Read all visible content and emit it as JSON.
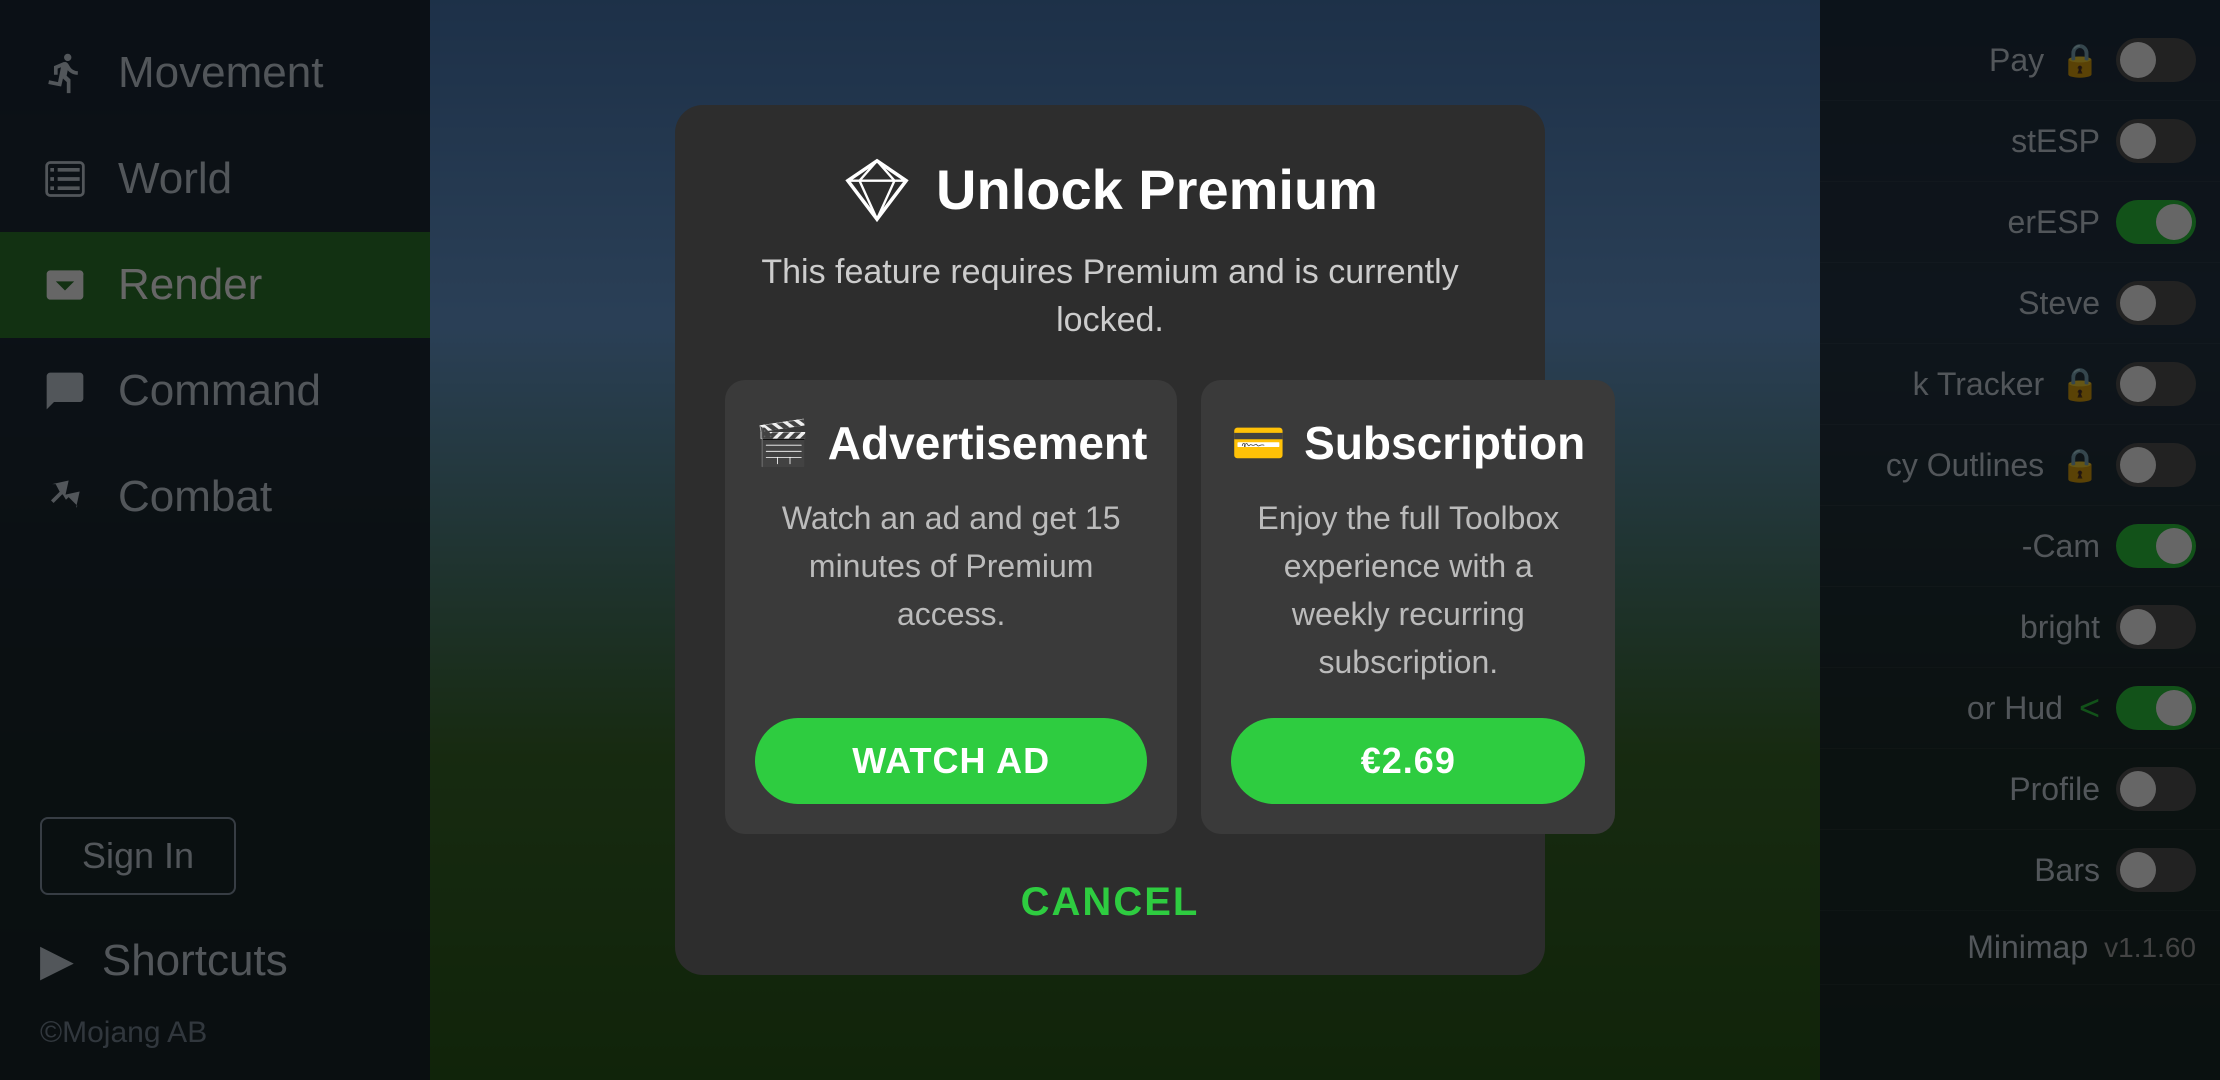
{
  "sidebar": {
    "items": [
      {
        "id": "movement",
        "label": "Movement",
        "icon": "🏃"
      },
      {
        "id": "world",
        "label": "World",
        "icon": "⬜"
      },
      {
        "id": "render",
        "label": "Render",
        "icon": "📷",
        "active": true
      },
      {
        "id": "command",
        "label": "Command",
        "icon": "💬"
      },
      {
        "id": "combat",
        "label": "Combat",
        "icon": "⚔"
      }
    ],
    "sign_in_label": "Sign In",
    "shortcuts_label": "Shortcuts",
    "shortcuts_icon": "▶",
    "mojang_label": "©Mojang AB"
  },
  "right_panel": {
    "items": [
      {
        "id": "pay",
        "label": "Pay",
        "locked": true,
        "toggle": "off"
      },
      {
        "id": "stESP",
        "label": "stESP",
        "locked": false,
        "toggle": "off"
      },
      {
        "id": "erESP",
        "label": "erESP",
        "locked": false,
        "toggle": "on"
      },
      {
        "id": "steve",
        "label": "Steve",
        "locked": false,
        "toggle": "off"
      },
      {
        "id": "tracker",
        "label": "k Tracker",
        "locked": true,
        "toggle": "off"
      },
      {
        "id": "outlines",
        "label": "cy Outlines",
        "locked": true,
        "toggle": "off"
      },
      {
        "id": "cam",
        "label": "-Cam",
        "locked": false,
        "toggle": "on"
      },
      {
        "id": "bright",
        "label": "bright",
        "locked": false,
        "toggle": "off"
      },
      {
        "id": "hud",
        "label": "or Hud",
        "locked": false,
        "toggle": "chevron",
        "chevron": "<"
      },
      {
        "id": "profile",
        "label": "Profile",
        "locked": false,
        "toggle": "off"
      },
      {
        "id": "bars",
        "label": "Bars",
        "locked": false,
        "toggle": "off"
      },
      {
        "id": "minimap",
        "label": "Minimap",
        "locked": false,
        "version": "v1.1.60"
      }
    ]
  },
  "modal": {
    "title": "Unlock Premium",
    "subtitle": "This feature requires Premium and is currently locked.",
    "advertisement": {
      "title": "Advertisement",
      "description": "Watch an ad and get 15 minutes of Premium access.",
      "button_label": "WATCH AD"
    },
    "subscription": {
      "title": "Subscription",
      "description": "Enjoy the full Toolbox experience with a weekly recurring subscription.",
      "button_label": "€2.69"
    },
    "cancel_label": "CANCEL"
  }
}
